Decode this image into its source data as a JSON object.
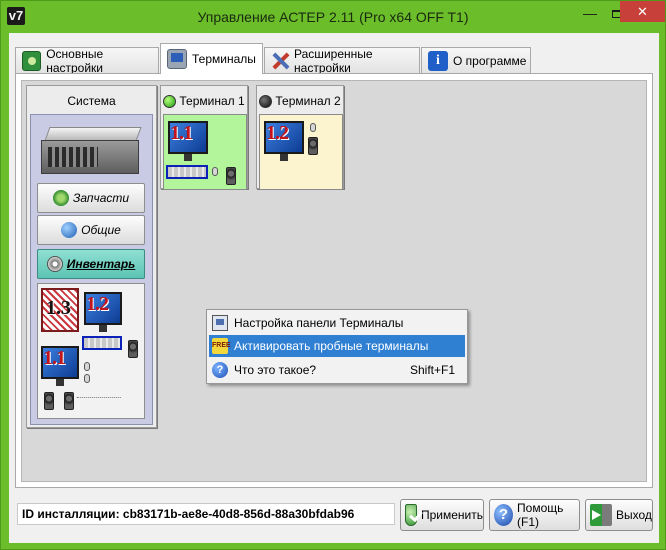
{
  "window": {
    "logo": "v7",
    "title": "Управление АСТЕР 2.11 (Pro x64 OFF T1)",
    "controls": {
      "minimize": "—",
      "close": "✕"
    }
  },
  "tabs": [
    {
      "label": "Основные настройки",
      "icon": "settings-icon"
    },
    {
      "label": "Терминалы",
      "icon": "terminal-icon",
      "active": true
    },
    {
      "label": "Расширенные настройки",
      "icon": "tools-icon"
    },
    {
      "label": "О программе",
      "icon": "info-icon",
      "glyph": "i"
    }
  ],
  "system": {
    "title": "Система",
    "buttons": [
      {
        "label": "Запчасти",
        "icon": "recycle-icon"
      },
      {
        "label": "Общие",
        "icon": "globe-icon"
      },
      {
        "label": "Инвентарь",
        "icon": "disk-icon",
        "active": true
      }
    ],
    "inventory": {
      "monitors": [
        "1.3",
        "1.2",
        "1.1"
      ]
    }
  },
  "terminals": [
    {
      "name": "Терминал 1",
      "status": "online",
      "monitor": "1.1",
      "color": "#b3f59b"
    },
    {
      "name": "Терминал 2",
      "status": "offline",
      "monitor": "1.2",
      "color": "#fbf4cf"
    }
  ],
  "context_menu": {
    "items": [
      {
        "label": "Настройка панели Терминалы",
        "icon": "panel-icon",
        "shortcut": ""
      },
      {
        "label": "Активировать пробные терминалы",
        "icon": "free-icon",
        "icon_text": "FREE",
        "shortcut": "",
        "highlighted": true
      },
      {
        "label": "Что это такое?",
        "icon": "help-icon",
        "icon_text": "?",
        "shortcut": "Shift+F1"
      }
    ]
  },
  "footer": {
    "install_id": "ID инсталляции: cb83171b-ae8e-40d8-856d-88a30bfdab96",
    "buttons": {
      "apply": "Применить",
      "help": "Помощь (F1)",
      "help_icon_text": "?",
      "exit": "Выход"
    }
  },
  "colors": {
    "window_frame": "#6bbd2a",
    "active_menu_item": "#2f7fd3",
    "close_button": "#c7413a",
    "inventory_button": "#5cc4b4"
  }
}
